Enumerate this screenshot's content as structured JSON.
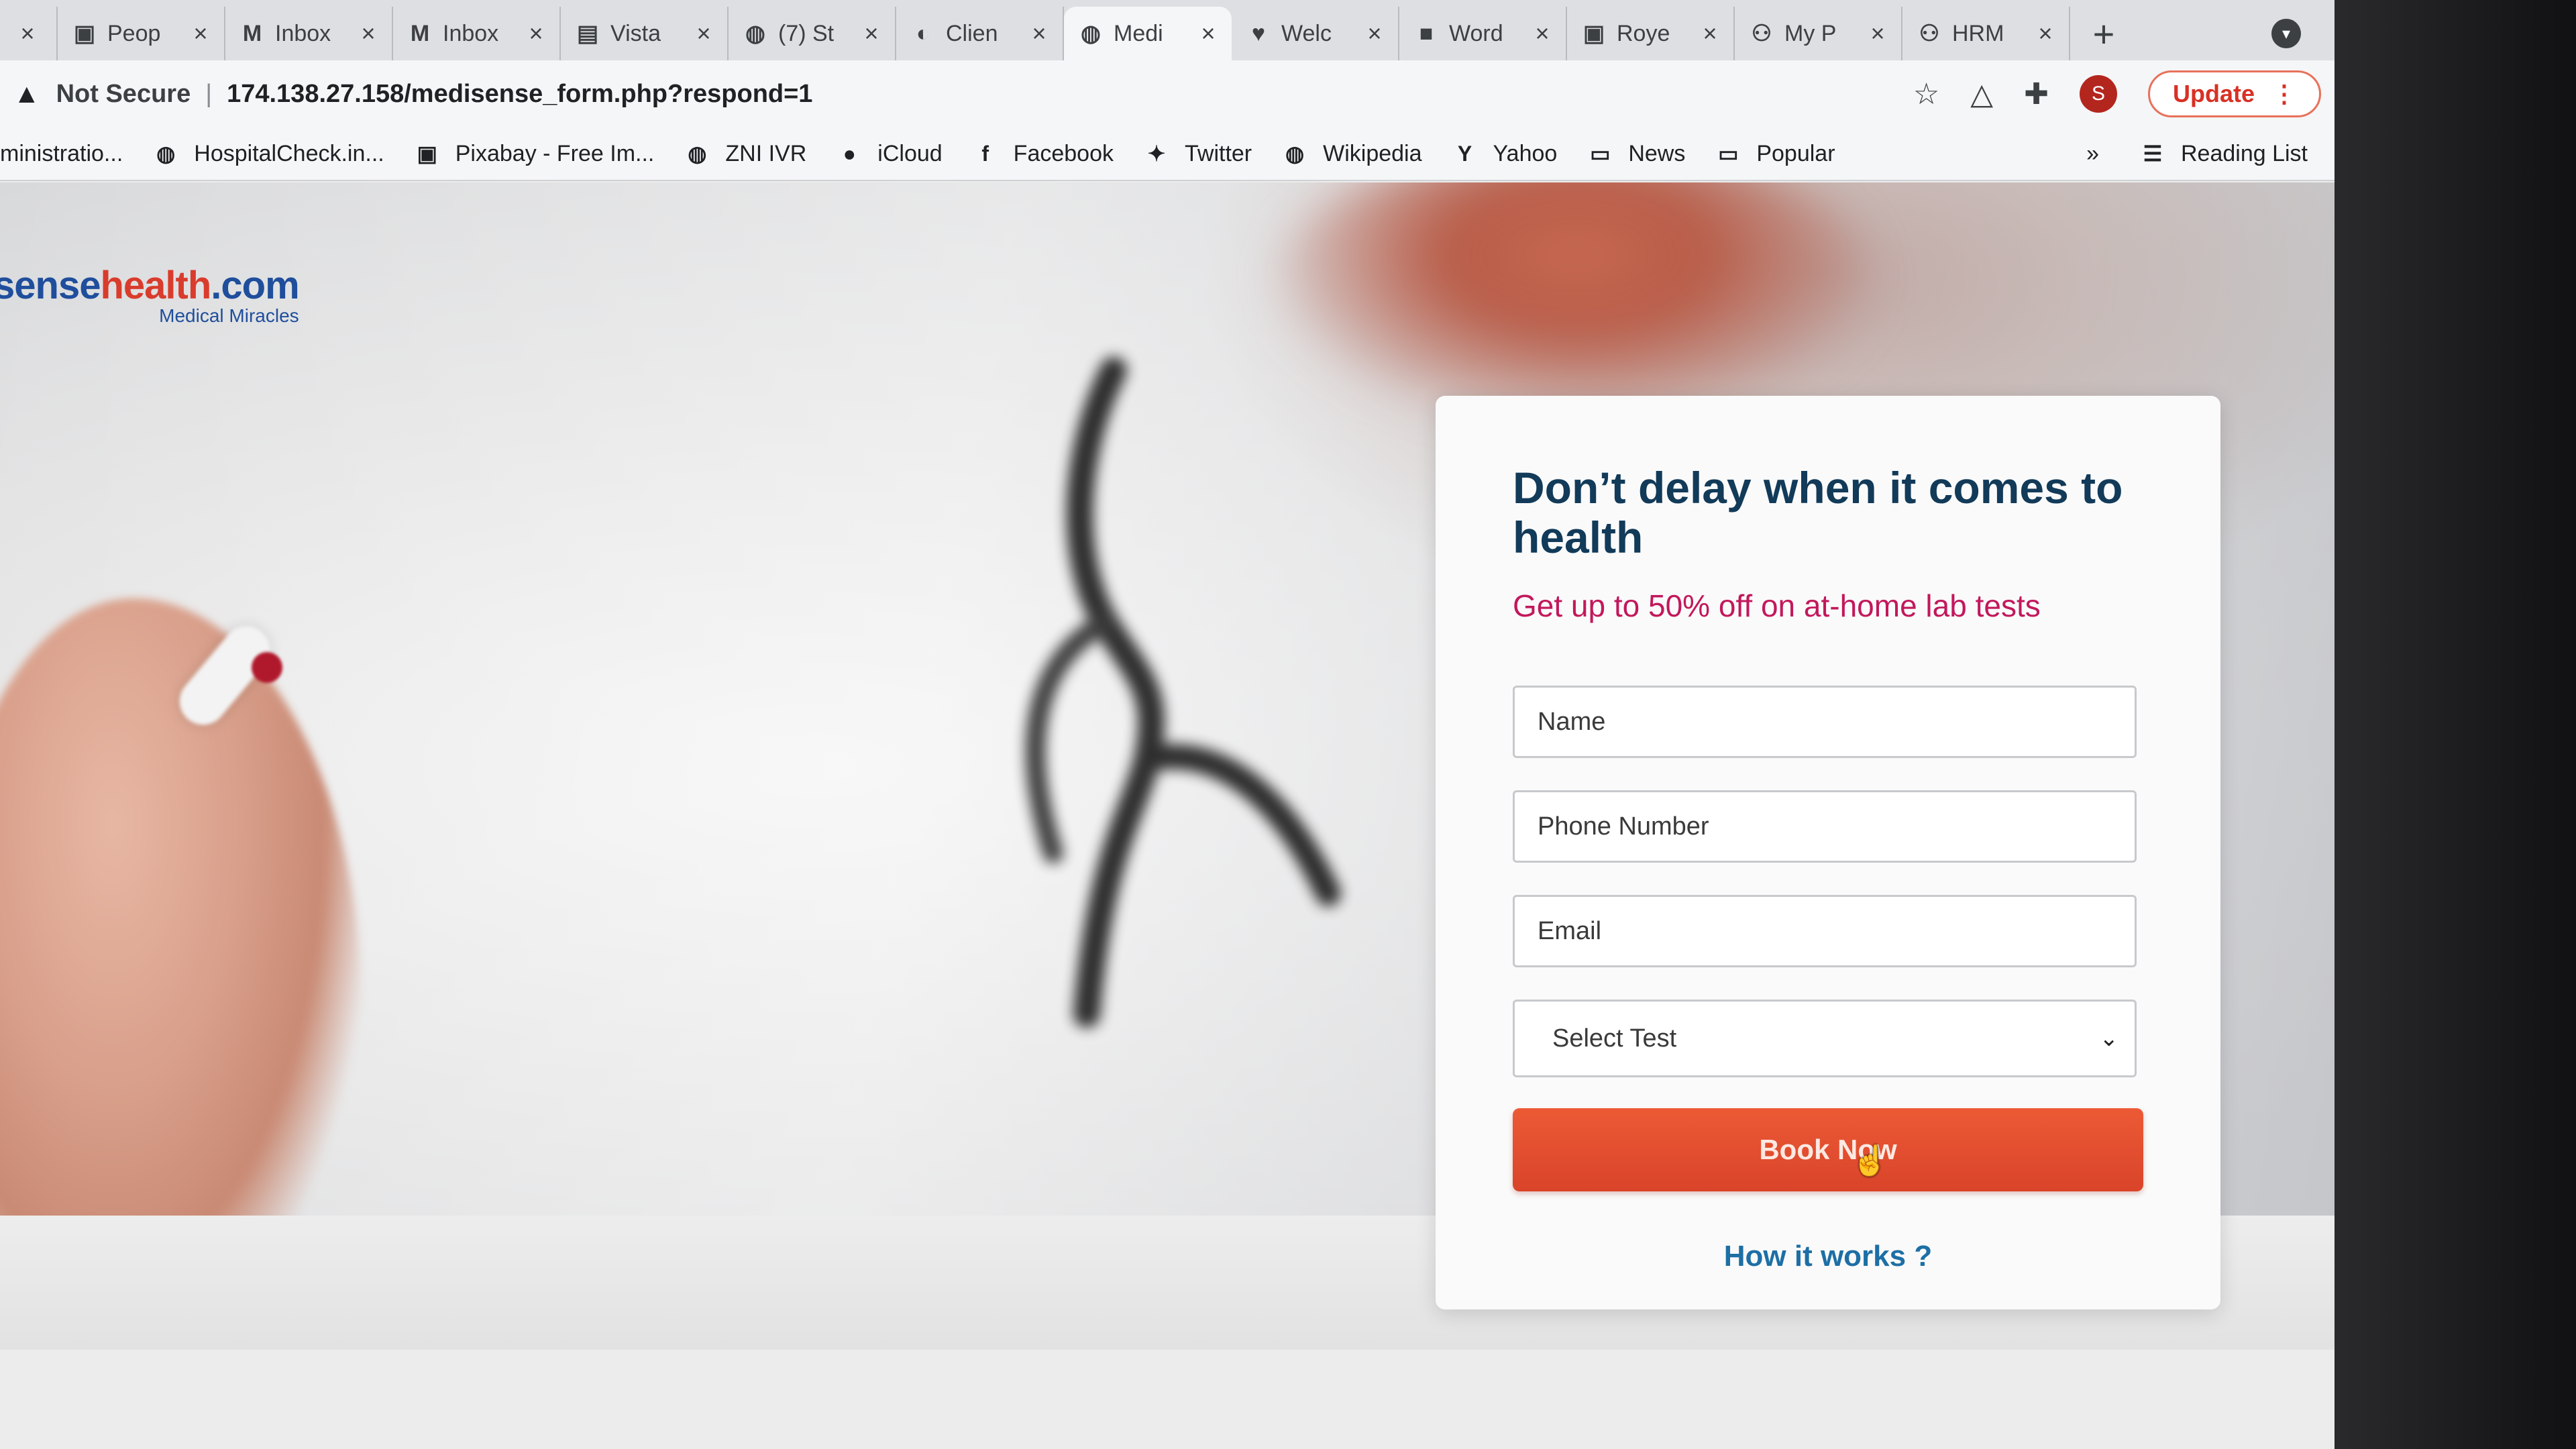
{
  "browser": {
    "tabs": [
      {
        "title": "",
        "icon": "tab-icon",
        "glyph": "",
        "active": false
      },
      {
        "title": "Peop",
        "icon": "contacts-icon",
        "glyph": "▣",
        "active": false
      },
      {
        "title": "Inbox",
        "icon": "gmail-icon",
        "glyph": "M",
        "active": false
      },
      {
        "title": "Inbox",
        "icon": "gmail-icon",
        "glyph": "M",
        "active": false
      },
      {
        "title": "Vista",
        "icon": "vista-icon",
        "glyph": "▤",
        "active": false
      },
      {
        "title": "(7) St",
        "icon": "globe-icon",
        "glyph": "◍",
        "active": false
      },
      {
        "title": "Clien",
        "icon": "client-icon",
        "glyph": "◐",
        "active": false
      },
      {
        "title": "Medi",
        "icon": "globe-icon",
        "glyph": "◍",
        "active": true
      },
      {
        "title": "Welc",
        "icon": "heart-icon",
        "glyph": "♥",
        "active": false
      },
      {
        "title": "Word",
        "icon": "word-icon",
        "glyph": "■",
        "active": false
      },
      {
        "title": "Roye",
        "icon": "contacts-icon",
        "glyph": "▣",
        "active": false
      },
      {
        "title": "My P",
        "icon": "people-icon",
        "glyph": "⚇",
        "active": false
      },
      {
        "title": "HRM",
        "icon": "people-icon",
        "glyph": "⚇",
        "active": false
      }
    ],
    "tab_close_glyph": "×",
    "new_tab_glyph": "+",
    "tab_search_glyph": "▾",
    "security_label": "Not Secure",
    "url": "174.138.27.158/medisense_form.php?respond=1",
    "warning_glyph": "▲",
    "separator": "|",
    "bookmark_star_glyph": "☆",
    "drive_glyph": "△",
    "extensions_glyph": "✚",
    "profile_initial": "S",
    "update_label": "Update",
    "menu_glyph": "⋮",
    "bookmarks": [
      {
        "label": "ministratio...",
        "icon": "",
        "glyph": ""
      },
      {
        "label": "HospitalCheck.in...",
        "icon": "globe-icon",
        "glyph": "◍"
      },
      {
        "label": "Pixabay - Free Im...",
        "icon": "pixabay-icon",
        "glyph": "▣"
      },
      {
        "label": "ZNI IVR",
        "icon": "globe-icon",
        "glyph": "◍"
      },
      {
        "label": "iCloud",
        "icon": "apple-icon",
        "glyph": "●"
      },
      {
        "label": "Facebook",
        "icon": "facebook-icon",
        "glyph": "f"
      },
      {
        "label": "Twitter",
        "icon": "twitter-icon",
        "glyph": "✦"
      },
      {
        "label": "Wikipedia",
        "icon": "globe-icon",
        "glyph": "◍"
      },
      {
        "label": "Yahoo",
        "icon": "yahoo-icon",
        "glyph": "Y"
      },
      {
        "label": "News",
        "icon": "folder-icon",
        "glyph": "▭"
      },
      {
        "label": "Popular",
        "icon": "folder-icon",
        "glyph": "▭"
      }
    ],
    "overflow_glyph": "»",
    "reading_list_label": "Reading List",
    "reading_list_glyph": "☰"
  },
  "page": {
    "logo": {
      "part1": "sense",
      "part2": "health",
      "part3": ".com",
      "tagline": "Medical Miracles"
    },
    "form": {
      "title": "Don’t delay when it comes to health",
      "subtitle": "Get up to 50% off on at-home lab tests",
      "name_placeholder": "Name",
      "phone_placeholder": "Phone Number",
      "email_placeholder": "Email",
      "select_value": "Select Test",
      "select_chevron": "⌄",
      "submit_label": "Book Now",
      "cursor_glyph": "☝",
      "how_it_works": "How it works ?"
    }
  },
  "colors": {
    "accent_red": "#d9442a",
    "title_navy": "#123a59",
    "subtitle_pink": "#c2185b",
    "link_blue": "#1d6fa5"
  }
}
